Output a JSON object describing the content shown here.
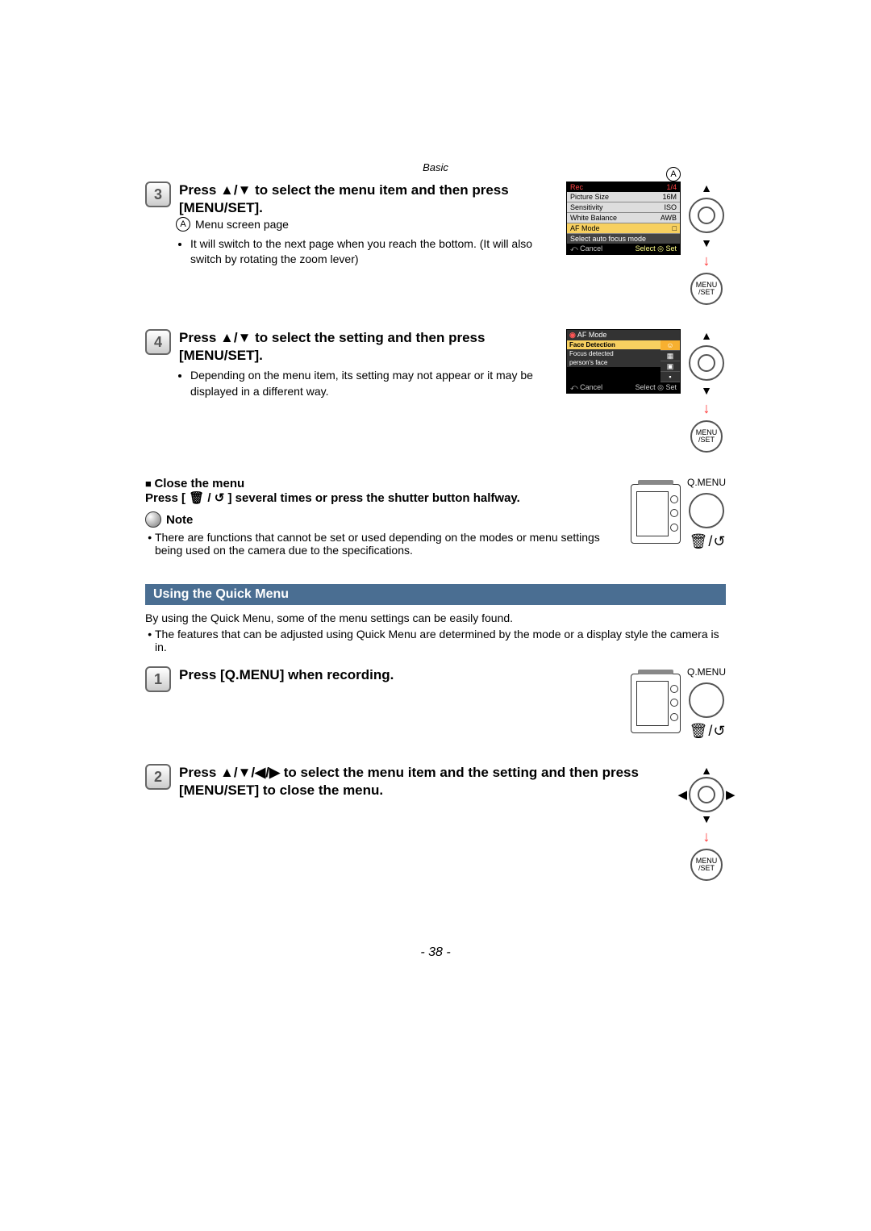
{
  "header": {
    "section": "Basic"
  },
  "step3": {
    "num": "3",
    "title_pre": "Press ",
    "arrows_updn": "▲/▼",
    "title_mid": " to select the menu item and then press [MENU/SET].",
    "a_label": "A",
    "a_text": "Menu screen page",
    "bullet1": "It will switch to the next page when you reach the bottom. (It will also switch by rotating the zoom lever)",
    "menu": {
      "title": "Rec",
      "page": "1/4",
      "rows": [
        {
          "l": "Picture Size",
          "r": "16M"
        },
        {
          "l": "Sensitivity",
          "r": "ISO"
        },
        {
          "l": "White Balance",
          "r": "AWB"
        },
        {
          "l": "AF Mode",
          "r": "□"
        }
      ],
      "hint": "Select auto focus mode",
      "cancel": "⤺ Cancel",
      "select": "Select ◎ Set"
    },
    "callout": "A"
  },
  "step4": {
    "num": "4",
    "title_pre": "Press ",
    "arrows_updn": "▲/▼",
    "title_mid": " to select the setting and then press [MENU/SET].",
    "bullet1": "Depending on the menu item, its setting may not appear or it may be displayed in a different way.",
    "menu": {
      "title": "AF Mode",
      "row1": "Face Detection",
      "row2": "Focus detected",
      "row3": "person's face",
      "cancel": "⤺ Cancel",
      "select": "Select ◎ Set"
    }
  },
  "close": {
    "heading": "Close the menu",
    "line_pre": "Press [",
    "icon": " 🗑 / ↺ ",
    "line_post": "] several times or press the shutter button halfway.",
    "note_label": "Note",
    "note_bullet": "There are functions that cannot be set or used depending on the modes or menu settings being used on the camera due to the specifications.",
    "qmenu": "Q.MENU",
    "trash_return": "🗑 / ↺"
  },
  "quick": {
    "heading": "Using the Quick Menu",
    "intro": "By using the Quick Menu, some of the menu settings can be easily found.",
    "bullet": "The features that can be adjusted using Quick Menu are determined by the mode or a display style the camera is in."
  },
  "qstep1": {
    "num": "1",
    "title": "Press [Q.MENU] when recording.",
    "qmenu": "Q.MENU",
    "trash_return": "🗑 / ↺"
  },
  "qstep2": {
    "num": "2",
    "title_pre": "Press ",
    "arrows": "▲/▼/◀/▶",
    "title_post": " to select the menu item and the setting and then press [MENU/SET] to close the menu."
  },
  "menuset_label": "MENU\n/SET",
  "page_number": "- 38 -"
}
